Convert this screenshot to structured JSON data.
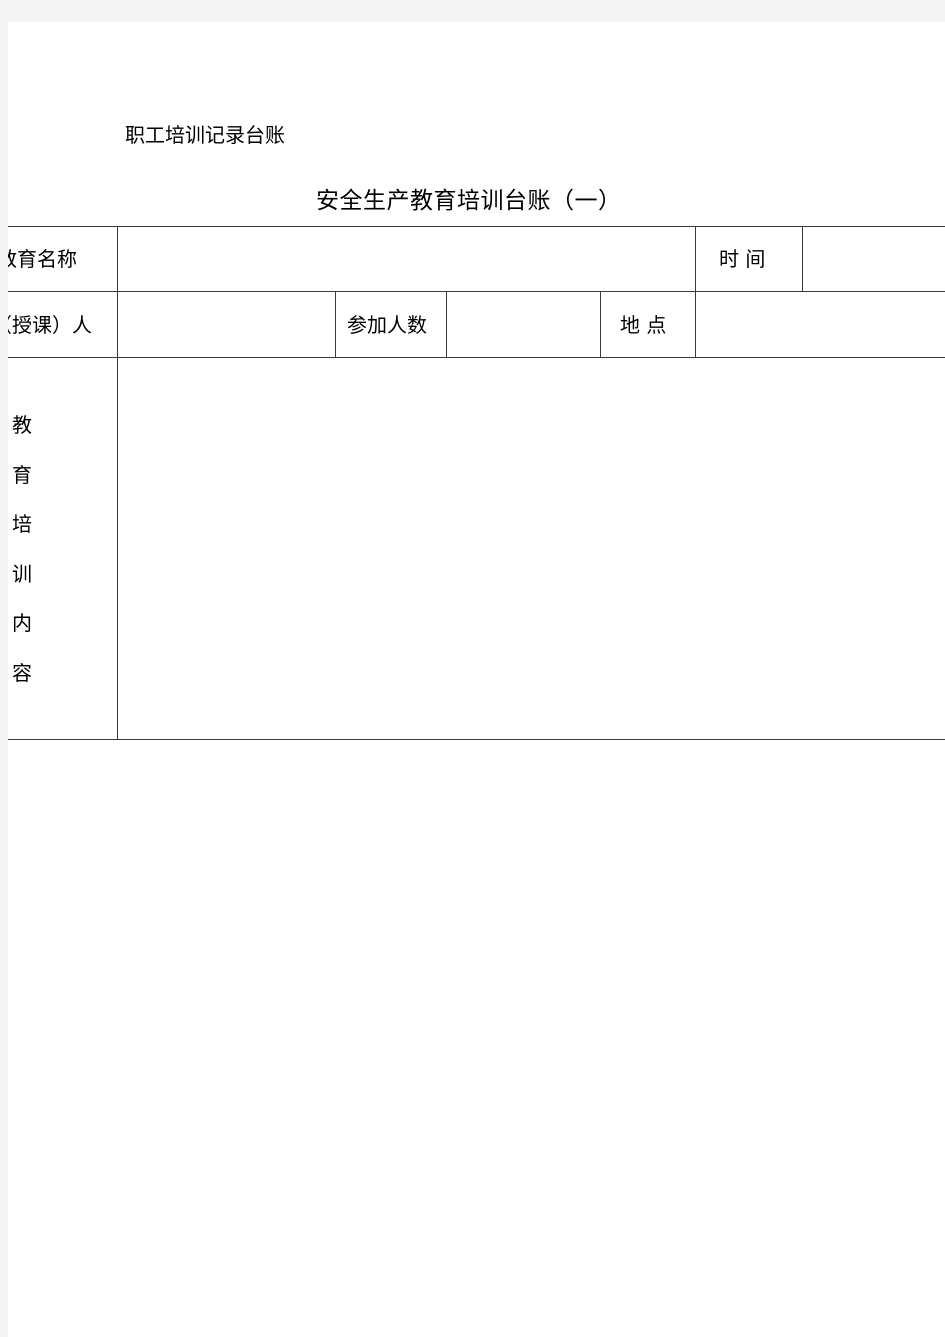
{
  "document": {
    "header_note": "职工培训记录台账",
    "title": "安全生产教育培训台账（一）"
  },
  "table": {
    "row1": {
      "education_name_label": "教育名称",
      "education_name_value": "",
      "time_label": "时 间",
      "time_value": ""
    },
    "row2": {
      "instructor_label": "（授课）人",
      "instructor_value": "",
      "participants_label": "参加人数",
      "participants_value": "",
      "location_label": "地 点",
      "location_value": ""
    },
    "row3": {
      "content_label_chars": [
        "教",
        "育",
        "培",
        "训",
        "内",
        "容"
      ],
      "content_value": ""
    }
  }
}
